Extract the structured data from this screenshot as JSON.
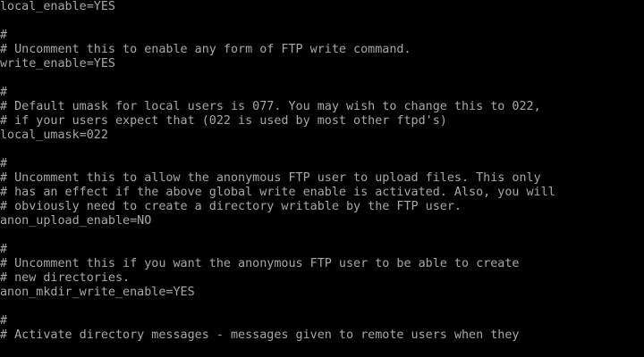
{
  "screen": {
    "text_color": "#a8a8a8",
    "background_color": "#000000",
    "lines": [
      "local_enable=YES",
      "",
      "#",
      "# Uncomment this to enable any form of FTP write command.",
      "write_enable=YES",
      "",
      "#",
      "# Default umask for local users is 077. You may wish to change this to 022,",
      "# if your users expect that (022 is used by most other ftpd's)",
      "local_umask=022",
      "",
      "#",
      "# Uncomment this to allow the anonymous FTP user to upload files. This only",
      "# has an effect if the above global write enable is activated. Also, you will",
      "# obviously need to create a directory writable by the FTP user.",
      "anon_upload_enable=NO",
      "",
      "#",
      "# Uncomment this if you want the anonymous FTP user to be able to create",
      "# new directories.",
      "anon_mkdir_write_enable=YES",
      "",
      "#",
      "# Activate directory messages - messages given to remote users when they"
    ]
  }
}
